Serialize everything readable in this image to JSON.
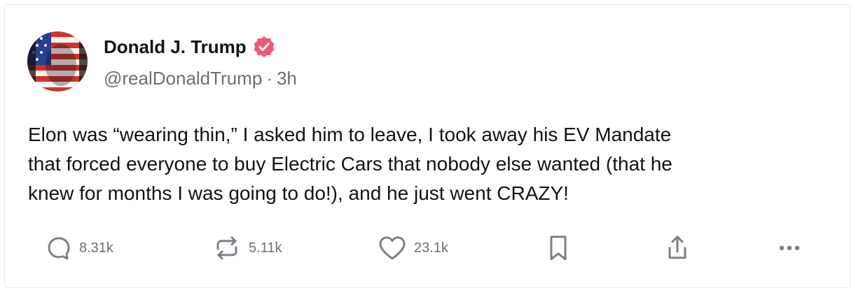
{
  "post": {
    "author_name": "Donald J. Trump",
    "handle": "@realDonaldTrump",
    "separator": "·",
    "time": "3h",
    "text": "Elon was “wearing thin,” I asked him to leave, I took away his EV Mandate\nthat forced everyone to buy Electric Cars that nobody else wanted (that he\nknew for months I was going to do!), and he just went CRAZY!"
  },
  "actions": {
    "replies": "8.31k",
    "reposts": "5.11k",
    "likes": "23.1k"
  },
  "icons": {
    "verified": "verified-badge-icon",
    "reply": "reply-icon",
    "repost": "repost-icon",
    "like": "heart-icon",
    "bookmark": "bookmark-icon",
    "share": "share-icon",
    "more": "more-icon"
  },
  "colors": {
    "verified": "#ee5a75",
    "text": "#0f1419",
    "muted": "#6b6f76",
    "icon": "#7b7f86"
  }
}
